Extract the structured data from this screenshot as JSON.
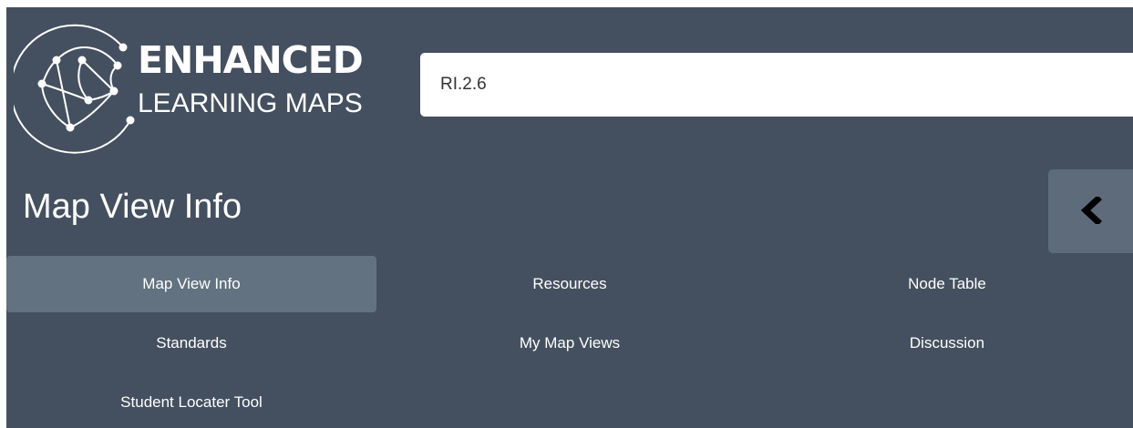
{
  "logo": {
    "line1": "ENHANCED",
    "line2": "LEARNING MAPS"
  },
  "search": {
    "value": "RI.2.6"
  },
  "panel": {
    "title": "Map View Info",
    "collapse_icon": "chevron-left-icon"
  },
  "tabs": [
    {
      "label": "Map View Info",
      "active": true
    },
    {
      "label": "Resources",
      "active": false
    },
    {
      "label": "Node Table",
      "active": false
    },
    {
      "label": "Standards",
      "active": false
    },
    {
      "label": "My Map Views",
      "active": false
    },
    {
      "label": "Discussion",
      "active": false
    },
    {
      "label": "Student Locater Tool",
      "active": false
    }
  ],
  "colors": {
    "panel_bg": "#44505f",
    "active_tab_bg": "#627281",
    "collapse_button_bg": "#5d6b7b",
    "text": "#ffffff"
  }
}
